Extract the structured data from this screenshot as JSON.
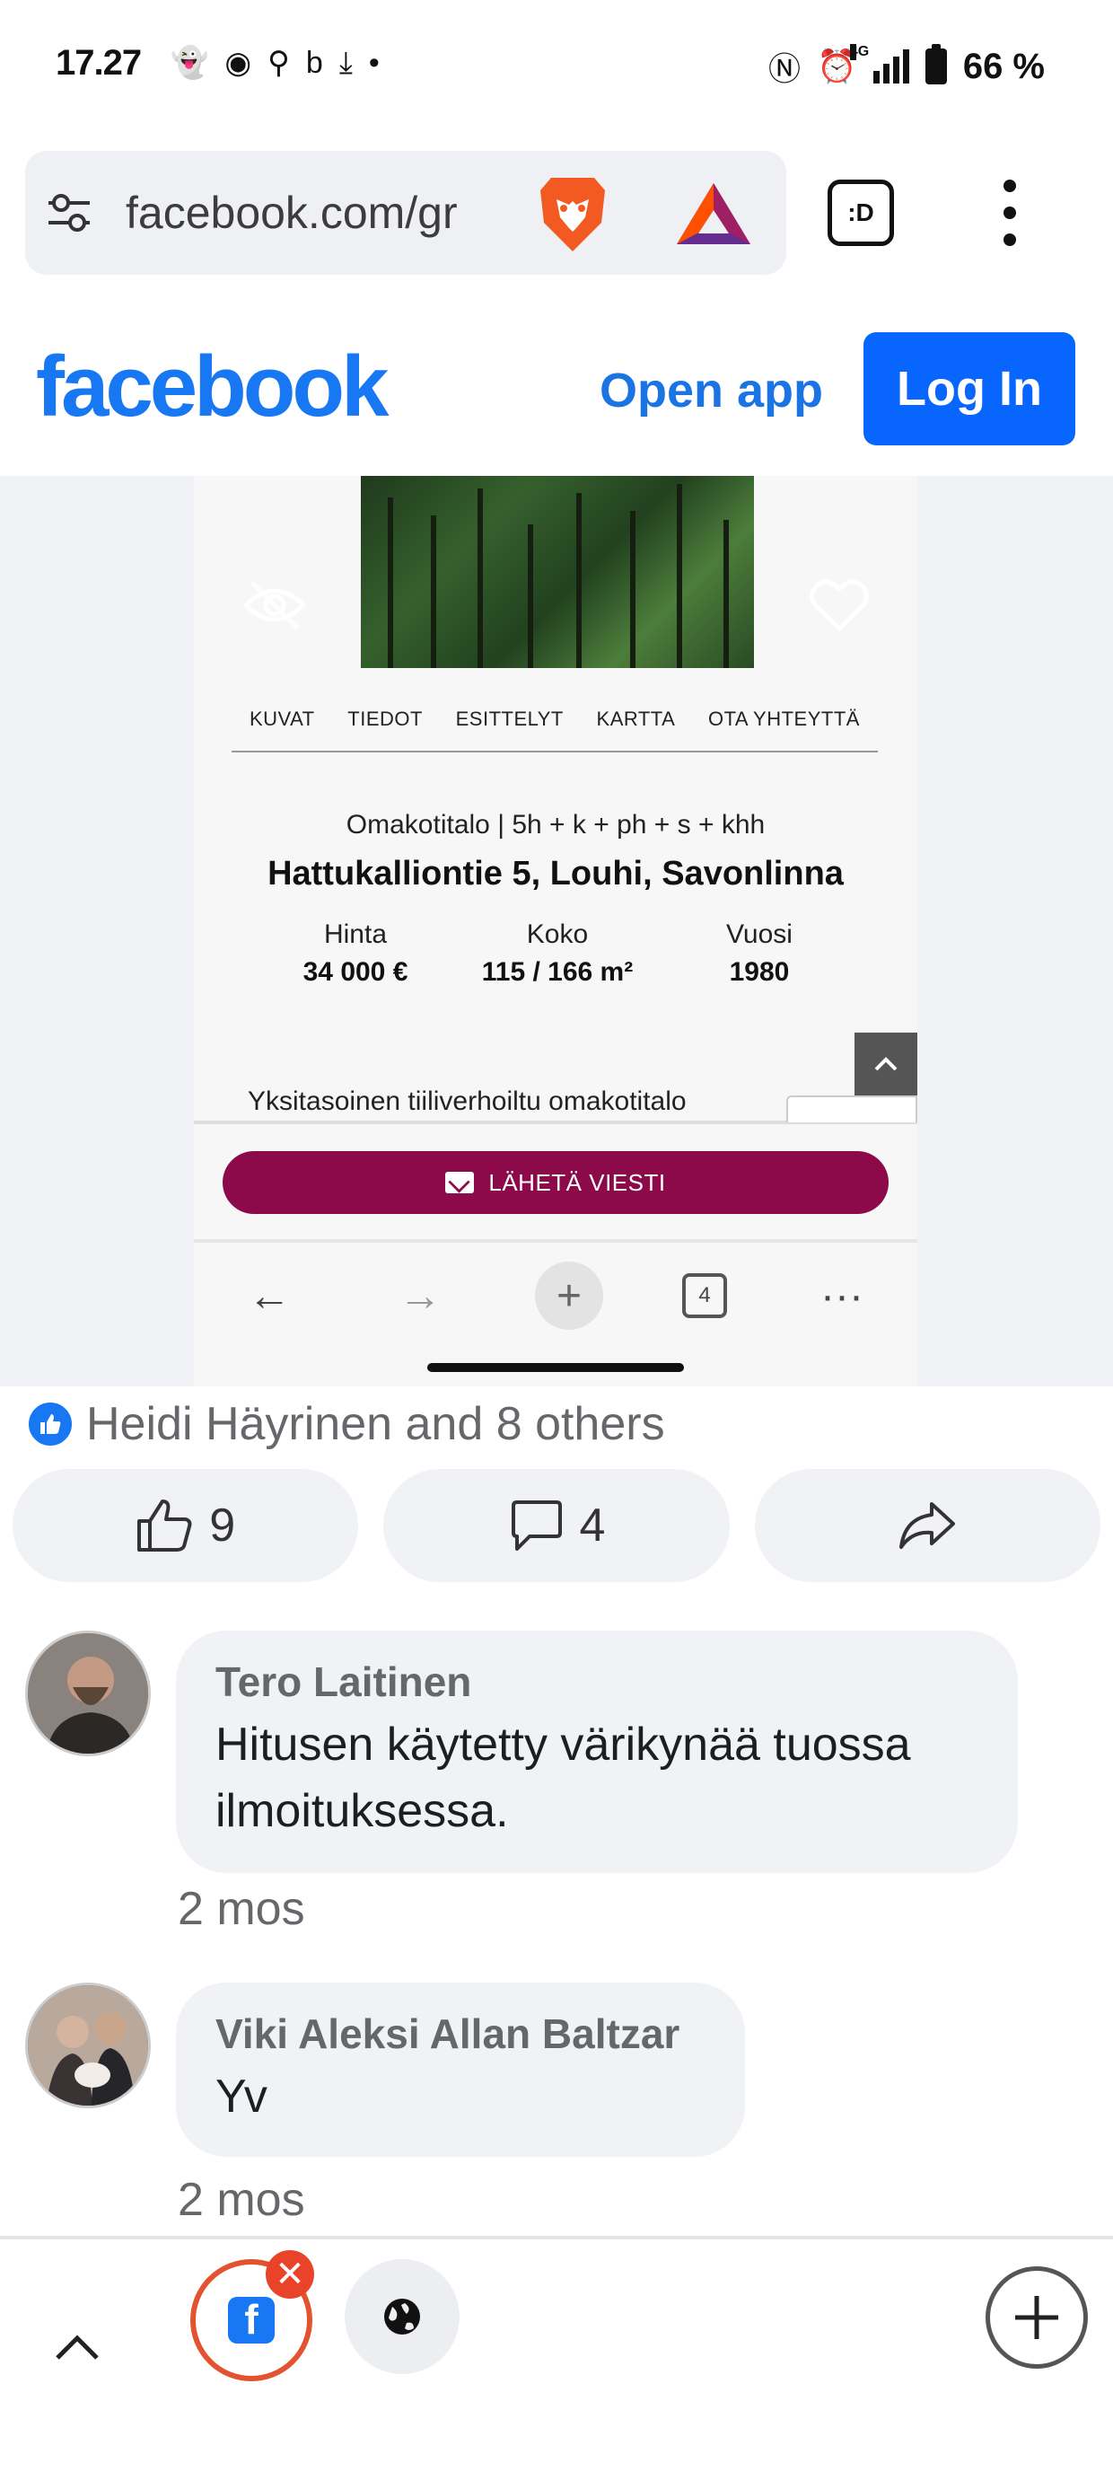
{
  "status_bar": {
    "time": "17.27",
    "network": "4G",
    "battery": "66 %"
  },
  "browser": {
    "url": "facebook.com/gr",
    "tabs_label": ":D"
  },
  "fb_header": {
    "logo": "facebook",
    "open_app": "Open app",
    "login": "Log In"
  },
  "listing": {
    "tabs": [
      "KUVAT",
      "TIEDOT",
      "ESITTELYT",
      "KARTTA",
      "OTA YHTEYTTÄ"
    ],
    "type": "Omakotitalo | 5h + k + ph + s + khh",
    "address": "Hattukalliontie 5, Louhi, Savonlinna",
    "stats": [
      {
        "label": "Hinta",
        "value": "34 000 €"
      },
      {
        "label": "Koko",
        "value": "115 / 166 m²"
      },
      {
        "label": "Vuosi",
        "value": "1980"
      }
    ],
    "description": "Yksitasoinen tiiliverhoiltu omakotitalo",
    "send_button": "LÄHETÄ VIESTI",
    "tab_count": "4"
  },
  "post": {
    "reactions_text": "Heidi Häyrinen and 8 others",
    "like_count": "9",
    "comment_count": "4"
  },
  "comments": [
    {
      "author": "Tero Laitinen",
      "text": "Hitusen käytetty värikynää tuossa ilmoituksessa.",
      "time": "2 mos"
    },
    {
      "author": "Viki Aleksi Allan Baltzar",
      "text": "Yv",
      "time": "2 mos"
    }
  ],
  "colors": {
    "facebook_blue": "#1877f2",
    "login_blue": "#0866ff",
    "send_button": "#8c0a4a",
    "close_badge": "#e9442a"
  }
}
